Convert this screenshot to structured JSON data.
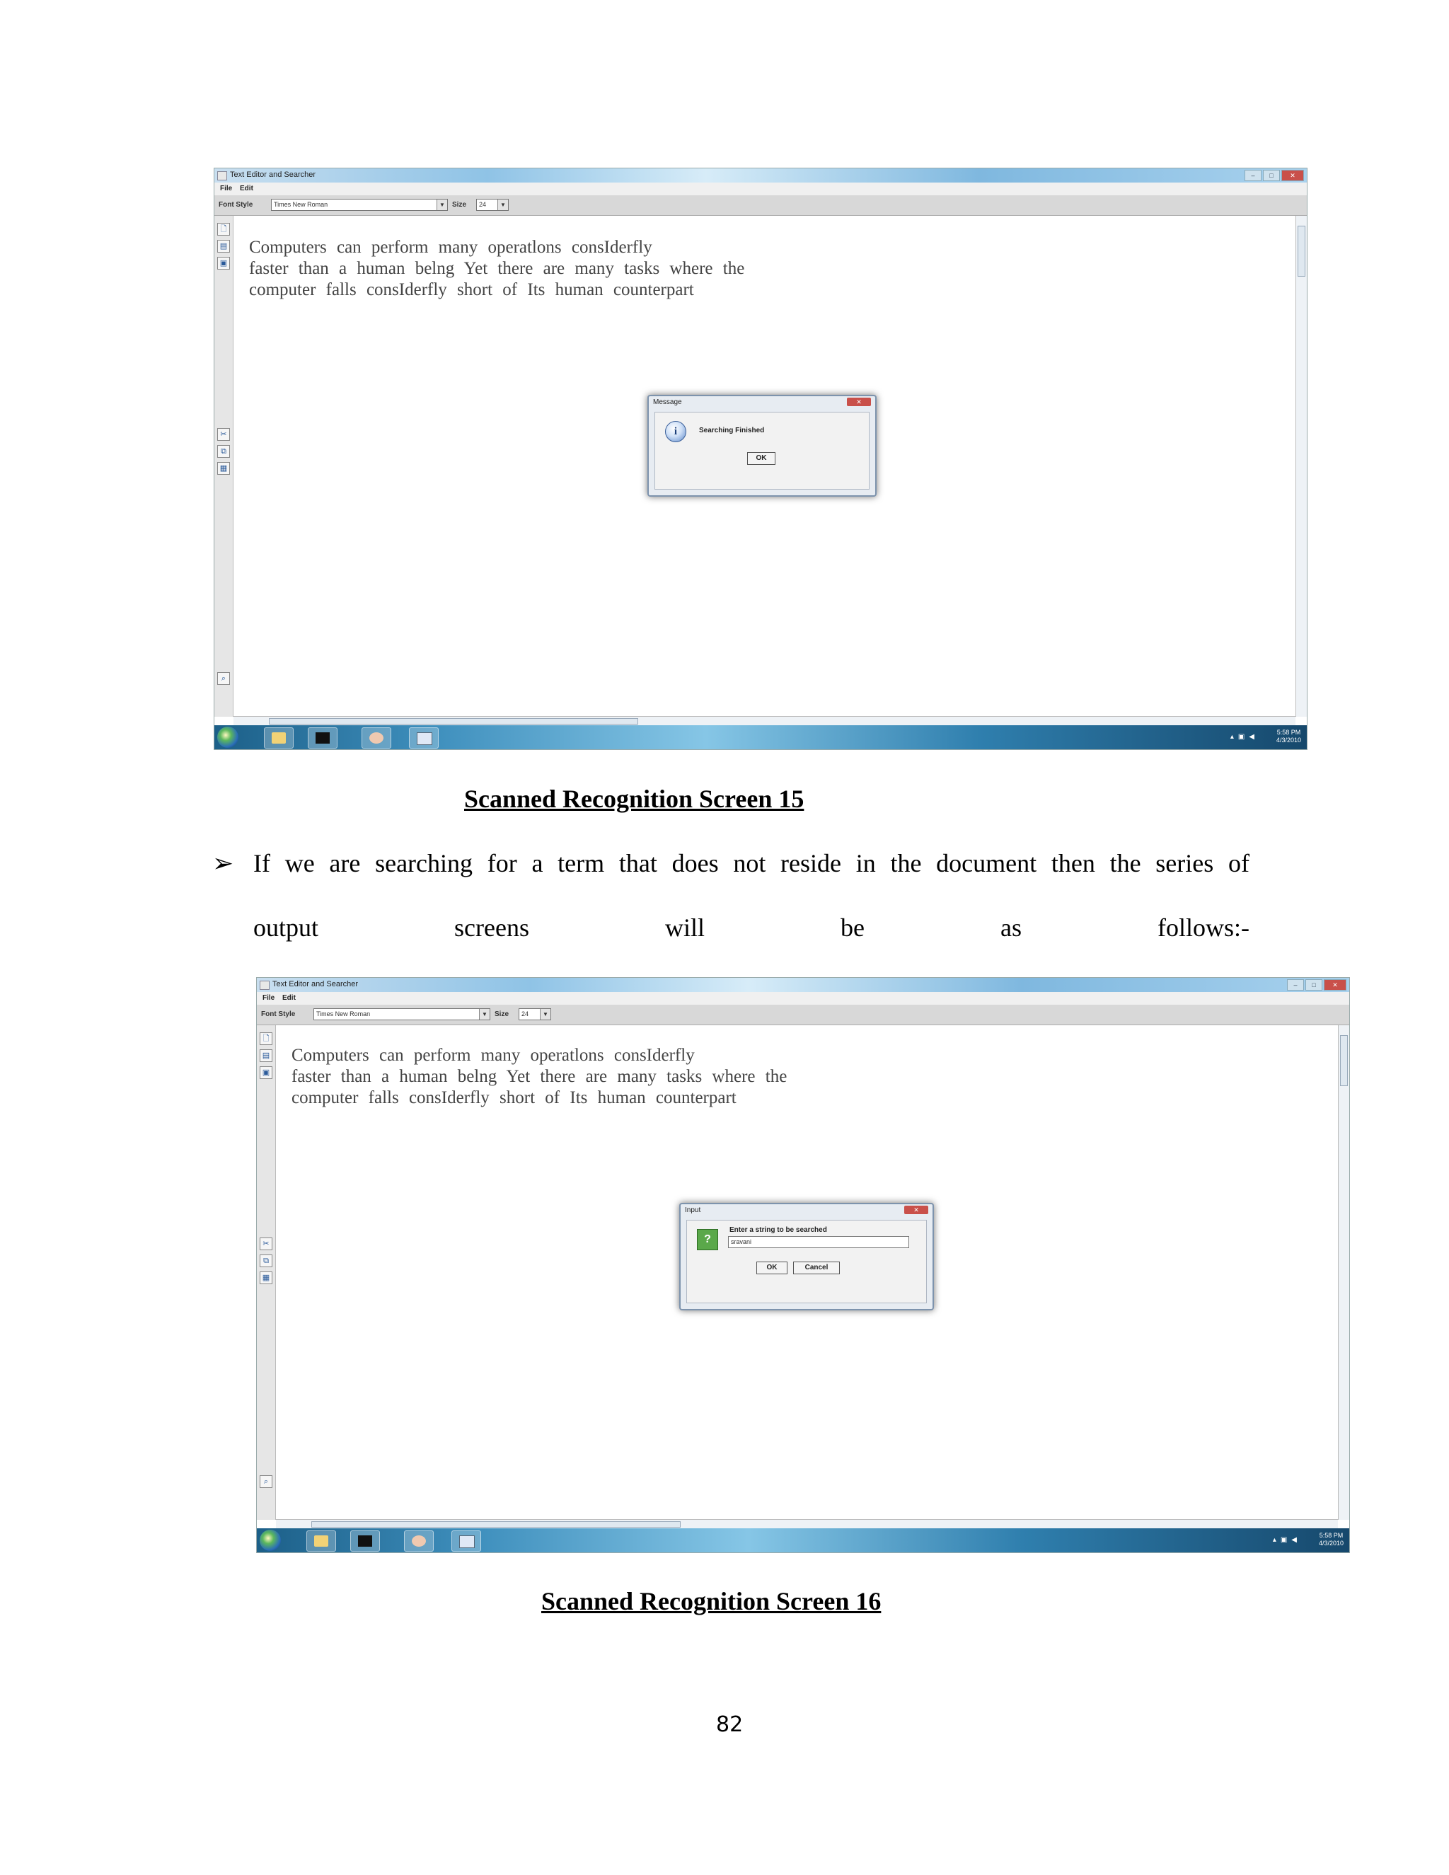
{
  "screens": [
    {
      "window_title": "Text Editor and Searcher",
      "menu": [
        "File",
        "Edit"
      ],
      "font_style_label": "Font Style",
      "font_style_value": "Times New Roman",
      "size_label": "Size",
      "size_value": "24",
      "editor_lines": [
        "Computers can perform many operatlons consIderfly",
        "faster than a human belng Yet there are many tasks where the",
        "computer falls consIderfly short of Its human counterpart"
      ],
      "dialog": {
        "title": "Message",
        "message": "Searching Finished",
        "ok": "OK"
      },
      "clock_time": "5:58 PM",
      "clock_date": "4/3/2010"
    },
    {
      "window_title": "Text Editor and Searcher",
      "menu": [
        "File",
        "Edit"
      ],
      "font_style_label": "Font Style",
      "font_style_value": "Times New Roman",
      "size_label": "Size",
      "size_value": "24",
      "editor_lines": [
        "Computers can perform many operatlons consIderfly",
        "faster than a human belng Yet there are many tasks where the",
        "computer falls consIderfly short of Its human counterpart"
      ],
      "dialog": {
        "title": "Input",
        "prompt": "Enter a string to be searched",
        "input_value": "sravani",
        "ok": "OK",
        "cancel": "Cancel"
      },
      "clock_time": "5:58 PM",
      "clock_date": "4/3/2010"
    }
  ],
  "captions": [
    "Scanned Recognition Screen 15",
    "Scanned Recognition Screen 16"
  ],
  "paragraph": {
    "bullet": "➢",
    "line1": "If we are searching for a term that does not reside in the document then the series of",
    "line2_words": [
      "output",
      "screens",
      "will",
      "be",
      "as",
      "follows:-"
    ]
  },
  "page_number": "82",
  "icons": {
    "dialog_info": "info-icon",
    "dialog_question": "question-icon",
    "start": "windows-start-icon"
  }
}
